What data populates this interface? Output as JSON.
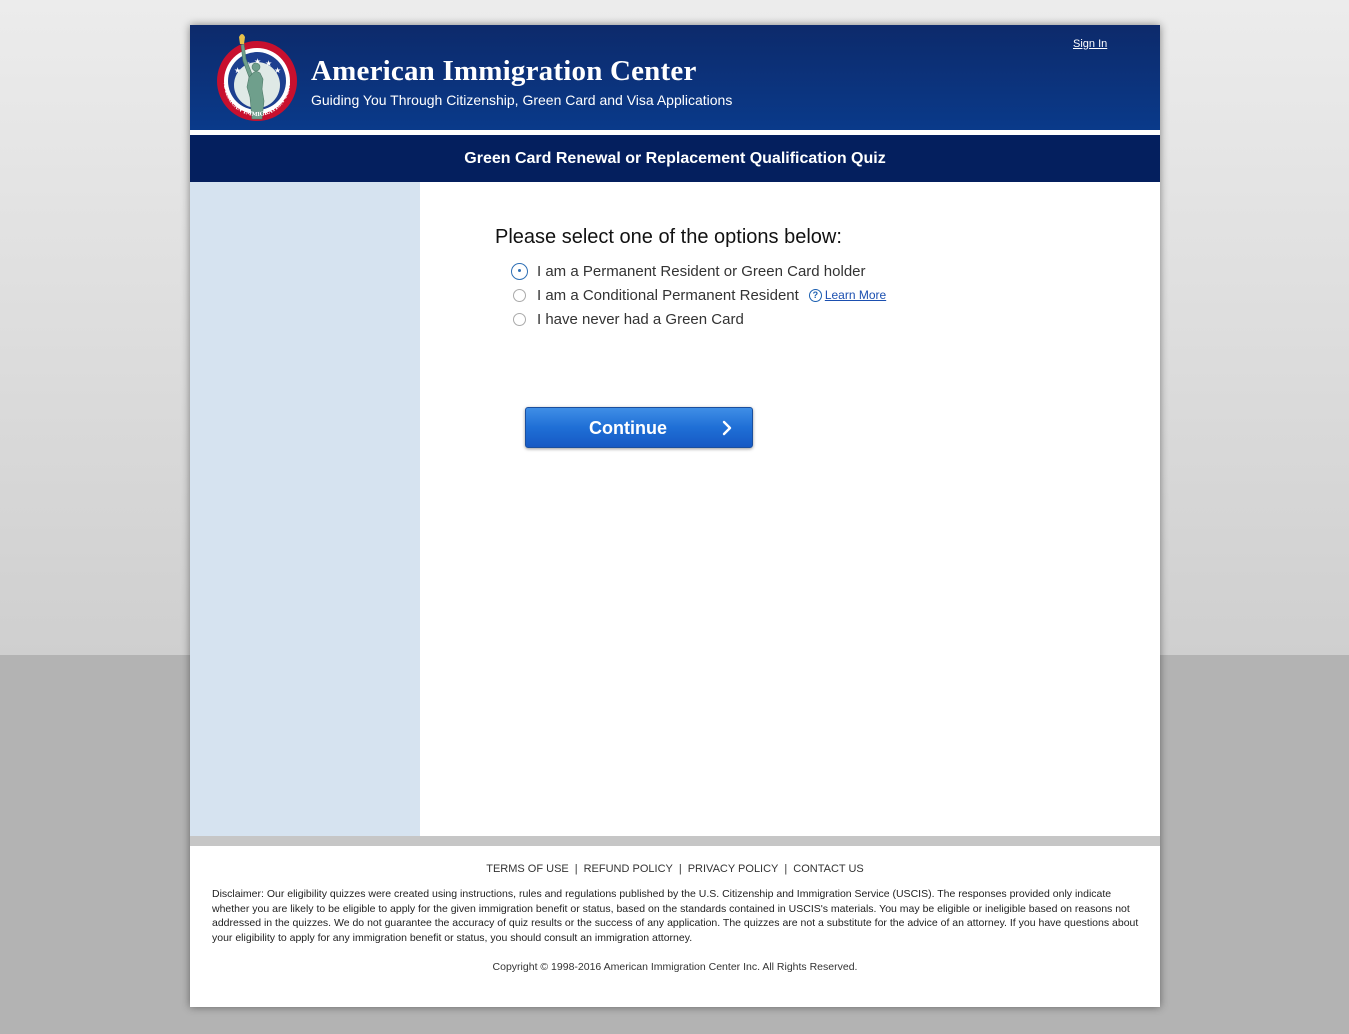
{
  "header": {
    "title": "American Immigration Center",
    "subtitle": "Guiding You Through Citizenship, Green Card and Visa Applications",
    "sign_in": "Sign In",
    "seal_text": "AMERICAN IMMIGRATION CENTER"
  },
  "quiz": {
    "title": "Green Card Renewal or Replacement Qualification Quiz",
    "prompt": "Please select one of the options below:",
    "options": [
      {
        "label": "I am a Permanent Resident or Green Card holder",
        "selected": true
      },
      {
        "label": "I am a Conditional Permanent Resident",
        "selected": false
      },
      {
        "label": "I have never had a Green Card",
        "selected": false
      }
    ],
    "learn_more": "Learn More",
    "continue_label": "Continue"
  },
  "footer": {
    "links": [
      "TERMS OF USE",
      "REFUND POLICY",
      "PRIVACY POLICY",
      "CONTACT US"
    ],
    "separator": "|",
    "disclaimer": "Disclaimer: Our eligibility quizzes were created using instructions, rules and regulations published by the U.S. Citizenship and Immigration Service (USCIS). The responses provided only indicate whether you are likely to be eligible to apply for the given immigration benefit or status, based on the standards contained in USCIS's materials. You may be eligible or ineligible based on reasons not addressed in the quizzes. We do not guarantee the accuracy of quiz results or the success of any application. The quizzes are not a substitute for the advice of an attorney. If you have questions about your eligibility to apply for any immigration benefit or status, you should consult an immigration attorney.",
    "copyright": "Copyright © 1998-2016 American Immigration Center Inc. All Rights Reserved."
  },
  "colors": {
    "header_blue": "#0a3a8a",
    "quiz_bar": "#041f5e",
    "sidebar": "#d6e3f0",
    "button_blue": "#1f6fd6"
  },
  "icons": [
    "statue-of-liberty-seal",
    "help-icon",
    "chevron-right-icon"
  ]
}
